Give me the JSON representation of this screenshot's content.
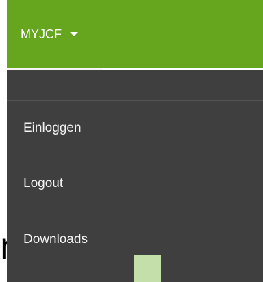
{
  "nav": {
    "menu_label": "MYJCF",
    "caret_icon": "chevron-down-icon"
  },
  "dropdown": {
    "items": [
      {
        "label": "Einloggen"
      },
      {
        "label": "Logout"
      },
      {
        "label": "Downloads"
      }
    ]
  },
  "colors": {
    "accent": "#66a61e",
    "dropdown_bg": "#3f3f3f",
    "text_light": "#f2f2f2"
  }
}
